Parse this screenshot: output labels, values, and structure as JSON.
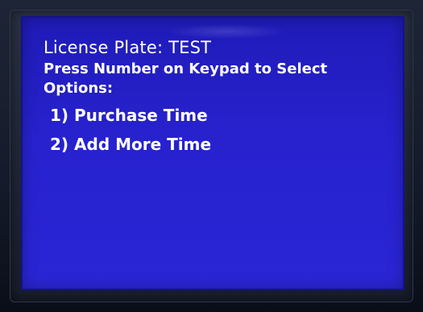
{
  "screen": {
    "license_plate_line": "License Plate: TEST",
    "instructions": "Press Number on Keypad to Select Options:",
    "options": [
      {
        "label": "1) Purchase Time"
      },
      {
        "label": "2) Add More Time"
      }
    ]
  },
  "colors": {
    "screen_background": "#2722ce",
    "text": "#ffffff",
    "bezel": "#1e2536"
  }
}
